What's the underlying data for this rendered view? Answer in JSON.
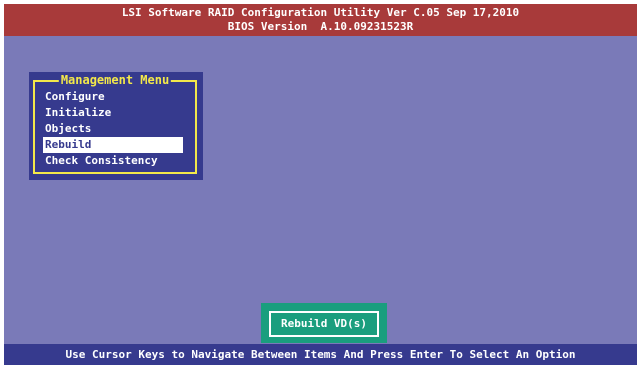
{
  "header": {
    "title_line1": "LSI Software RAID Configuration Utility Ver C.05 Sep 17,2010",
    "title_line2": "BIOS Version  A.10.09231523R"
  },
  "management_menu": {
    "title": "Management Menu",
    "items": [
      {
        "label": "Configure"
      },
      {
        "label": "Initialize"
      },
      {
        "label": "Objects"
      },
      {
        "label": "Rebuild"
      },
      {
        "label": "Check Consistency"
      }
    ],
    "selected_label": "Rebuild"
  },
  "action": {
    "label": "Rebuild VD(s)"
  },
  "status_bar": {
    "text": "Use Cursor Keys to Navigate Between Items And Press Enter To Select An Option"
  },
  "colors": {
    "background": "#7a7ab8",
    "title_bar": "#a83a3a",
    "menu_bg": "#363a8e",
    "menu_border": "#f3e84a",
    "action_bg": "#1a9e7e",
    "status_bar": "#363a8e"
  }
}
